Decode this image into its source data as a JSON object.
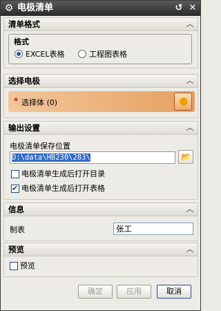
{
  "window": {
    "title": "电极清单",
    "gear_icon": "gear-icon",
    "restore_icon": "undo-icon",
    "close_icon": "close-icon"
  },
  "sections": {
    "list_format": {
      "header": "清单格式",
      "group_title": "格式",
      "options": [
        {
          "label": "EXCEL表格",
          "selected": true
        },
        {
          "label": "工程图表格",
          "selected": false
        }
      ]
    },
    "select_electrode": {
      "header": "选择电极",
      "required_mark": "*",
      "select_label": "选择体 (0)"
    },
    "output_settings": {
      "header": "输出设置",
      "save_location_label": "电极清单保存位置",
      "save_path": "D:\\data\\HB230\\283\\",
      "open_dir_label": "电极清单生成后打开目录",
      "open_dir_checked": false,
      "open_table_label": "电极清单生成后打开表格",
      "open_table_checked": true
    },
    "info": {
      "header": "信息",
      "maker_label": "制表",
      "maker_value": "张工"
    },
    "preview": {
      "header": "预览",
      "preview_label": "预览",
      "preview_checked": false
    }
  },
  "buttons": {
    "ok": "确定",
    "apply": "应用",
    "cancel": "取消"
  },
  "colors": {
    "title_bar": "#3a3a3a",
    "selection_accent": "#e6a060",
    "required_star": "#d01010"
  }
}
